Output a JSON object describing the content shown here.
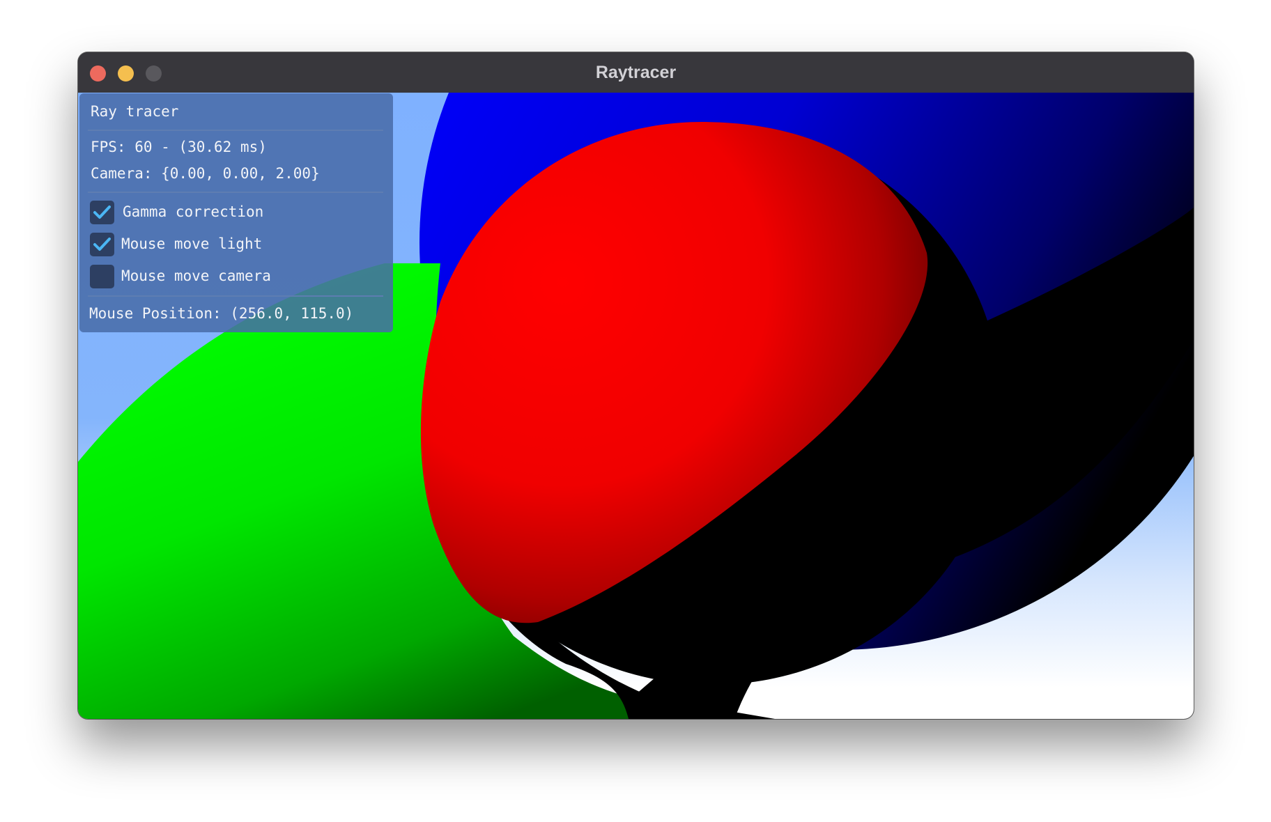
{
  "window": {
    "title": "Raytracer",
    "controls": [
      "close",
      "minimize",
      "maximize"
    ]
  },
  "panel": {
    "heading": "Ray tracer",
    "fps": "FPS: 60 - (30.62 ms)",
    "camera": "Camera: {0.00, 0.00, 2.00}",
    "options": [
      {
        "label": "Gamma correction",
        "checked": true
      },
      {
        "label": "Mouse move light",
        "checked": true
      },
      {
        "label": "Mouse move camera",
        "checked": false
      }
    ],
    "mouse_position": "Mouse Position: (256.0, 115.0)"
  },
  "scene": {
    "spheres": [
      {
        "name": "green-sphere",
        "color": "#00ff00"
      },
      {
        "name": "blue-sphere",
        "color": "#0000ff"
      },
      {
        "name": "red-sphere",
        "color": "#ff0000"
      }
    ],
    "sky_colors": [
      "#80b2ff",
      "#ffffff"
    ],
    "shadow_color": "#000000"
  },
  "colors": {
    "titlebar": "#38373c",
    "panel": "#486ba8",
    "checkmark": "#4bb6f4"
  }
}
